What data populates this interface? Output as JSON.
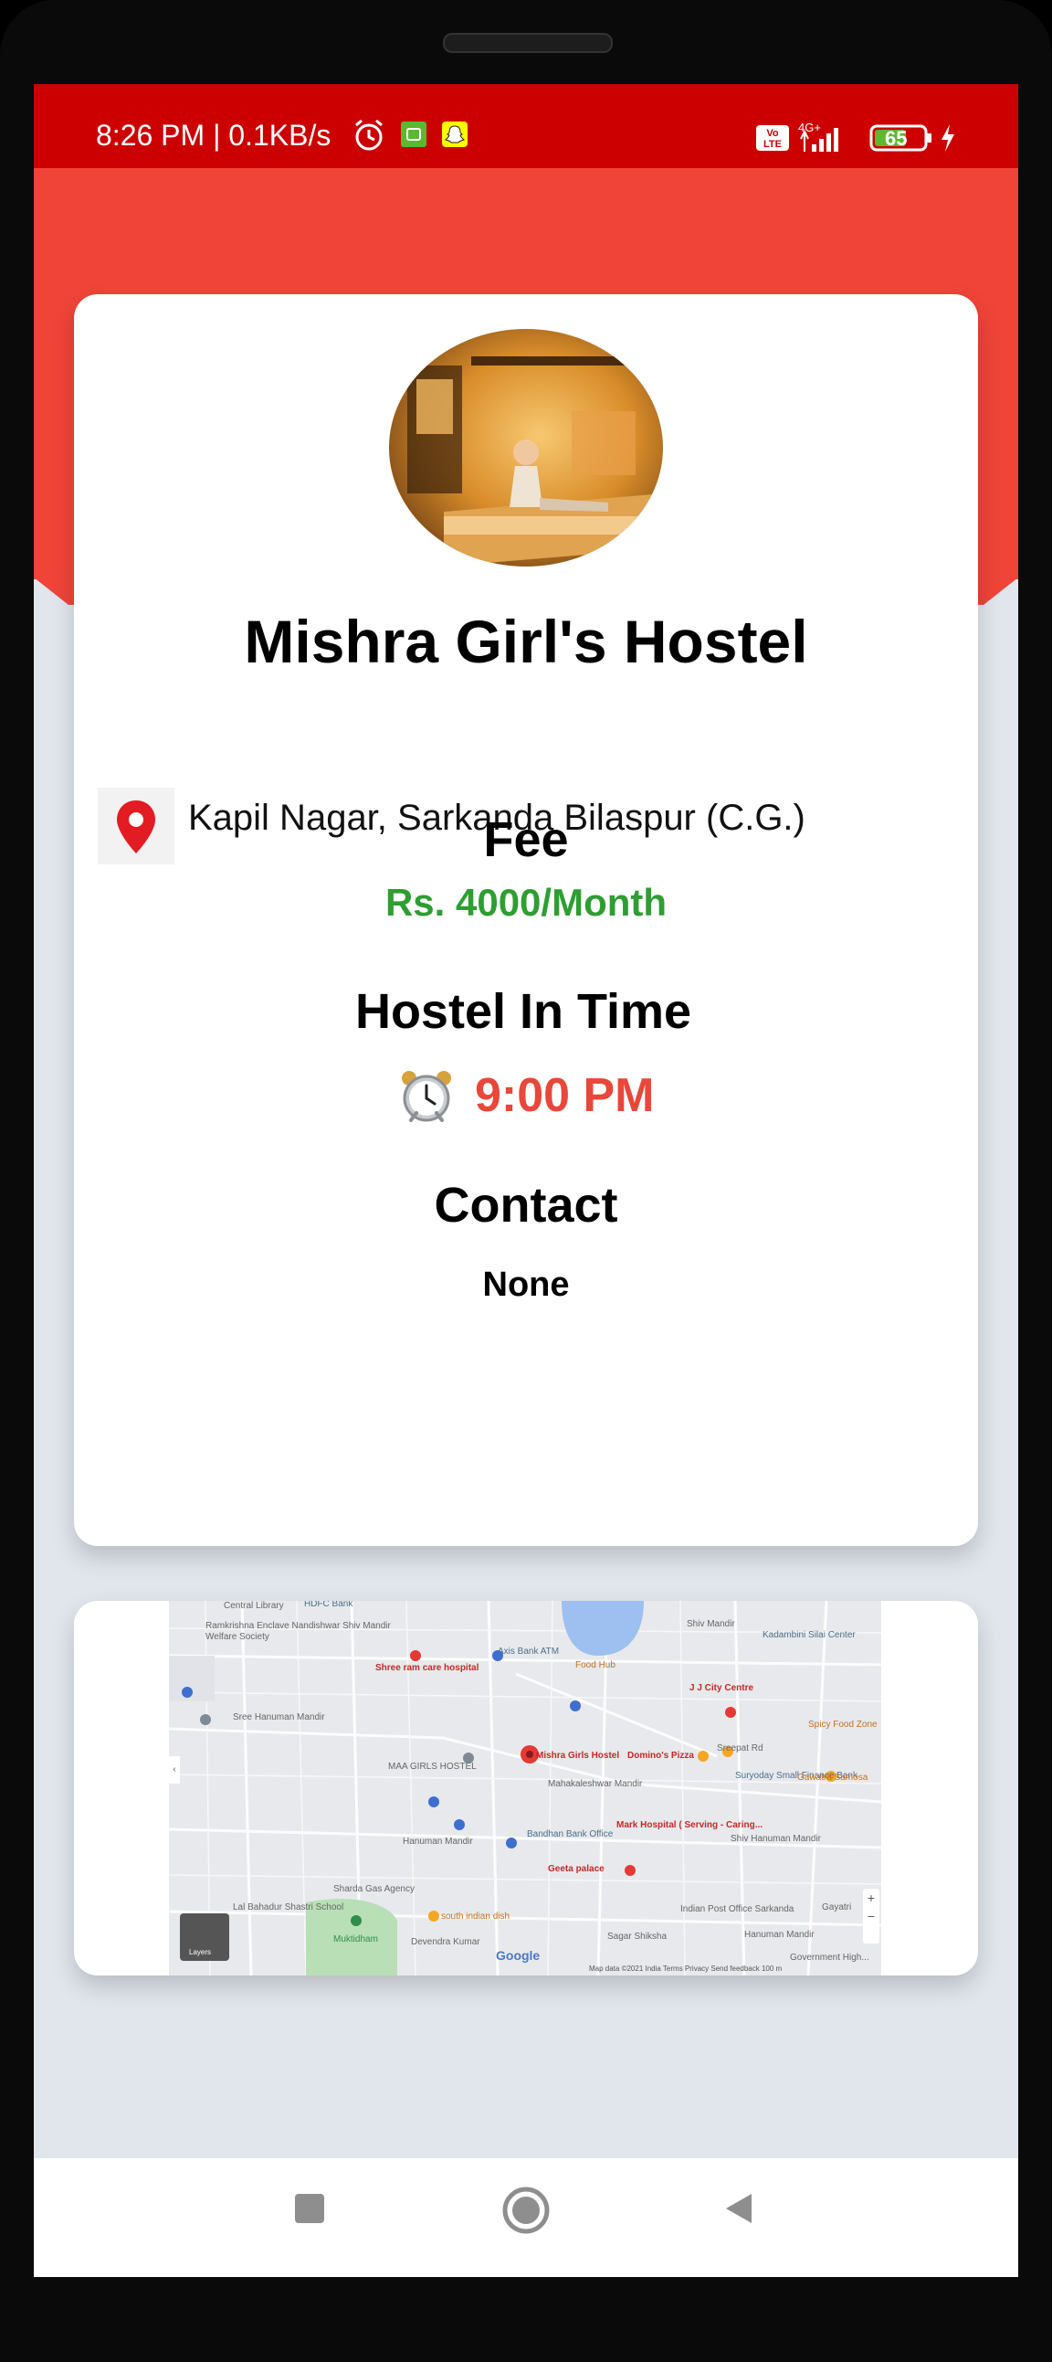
{
  "status_bar": {
    "time": "8:26 PM | 0.1KB/s",
    "network": "4G+",
    "battery": "65",
    "volte": "Vo LTE",
    "icons": [
      "alarm-icon",
      "app-notification-icon",
      "snapchat-icon",
      "volte-icon",
      "signal-icon",
      "battery-icon",
      "charging-icon"
    ]
  },
  "hostel": {
    "name": "Mishra Girl's Hostel",
    "address": "Kapil Nagar, Sarkanda Bilaspur (C.G.)",
    "fee_heading": "Fee",
    "fee_value": "Rs. 4000/Month",
    "in_time_heading": "Hostel In Time",
    "in_time_value": "9:00 PM",
    "contact_heading": "Contact",
    "contact_value": "None"
  },
  "map": {
    "labels": {
      "hdfc": "HDFC Bank",
      "central_library": "Central Library",
      "ramkrishna": "Ramkrishna Enclave Nandishwar Shiv Mandir",
      "welfare": "Welfare Society",
      "shree_ram": "Shree ram care hospital",
      "axis": "Axis Bank ATM",
      "food_hub": "Food Hub",
      "shiv_mandir": "Shiv Mandir",
      "kadambini": "Kadambini Silai Center",
      "jj_city": "J J City Centre",
      "hanuman1": "Sree Hanuman Mandir",
      "spicy": "Spicy Food Zone",
      "maa": "MAA GIRLS HOSTEL",
      "mishra": "Mishra Girls Hostel",
      "dominos": "Domino's Pizza",
      "sreepat": "Sreepat Rd",
      "suryoday": "Suryoday Small Finance Bank",
      "gawatra": "Gawatra Samosa",
      "mahakaleshwar": "Mahakaleshwar Mandir",
      "bandhan": "Bandhan Bank Office",
      "mark": "Mark Hospital ( Serving - Caring...",
      "shiv_hanuman": "Shiv Hanuman Mandir",
      "hanuman2": "Hanuman Mandir",
      "geeta": "Geeta palace",
      "sharda": "Sharda Gas Agency",
      "lal_bahadur": "Lal Bahadur Shastri School",
      "south_indian": "south indian dish",
      "muktidham": "Muktidham",
      "devendra": "Devendra Kumar",
      "sagar": "Sagar Shiksha",
      "indian_post": "Indian Post Office Sarkanda",
      "hanuman3": "Hanuman Mandir",
      "gayatri": "Gayatri",
      "govt": "Government High..."
    },
    "layers_label": "Layers",
    "google": "Google",
    "footer": "Map data ©2021   India   Terms   Privacy   Send feedback   100 m"
  },
  "nav": {
    "recent": "recent-apps-button",
    "home": "home-button",
    "back": "back-button"
  },
  "colors": {
    "status_bar": "#cc0000",
    "hero": "#f04438",
    "background": "#e1e6ed",
    "fee": "#2e9e32",
    "time": "#e8473a"
  }
}
